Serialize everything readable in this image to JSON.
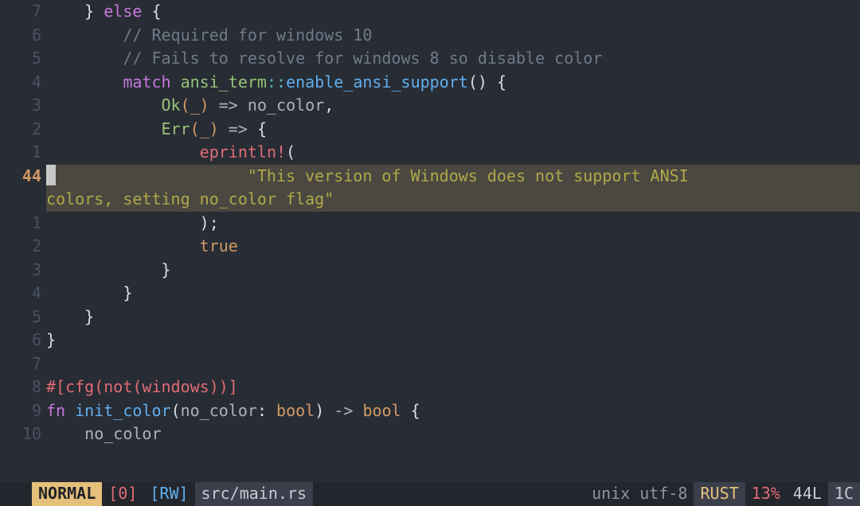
{
  "gutter": [
    "7",
    "6",
    "5",
    "4",
    "3",
    "2",
    "1",
    "44",
    "",
    "1",
    "2",
    "3",
    "4",
    "5",
    "6",
    "7",
    "8",
    "9",
    "10"
  ],
  "code": {
    "l0": {
      "indent": "    ",
      "brace1": "}",
      "sp": " ",
      "kw": "else",
      "sp2": " ",
      "brace2": "{"
    },
    "l1": {
      "indent": "        ",
      "comment": "// Required for windows 10"
    },
    "l2": {
      "indent": "        ",
      "comment": "// Fails to resolve for windows 8 so disable color"
    },
    "l3": {
      "indent": "        ",
      "kw": "match",
      "sp": " ",
      "mod": "ansi_term",
      "cc": "::",
      "fn": "enable_ansi_support",
      "paren": "()",
      "sp2": " ",
      "brace": "{"
    },
    "l4": {
      "indent": "            ",
      "ctor": "Ok",
      "args": "(_)",
      "sp": " ",
      "arrow": "=>",
      "sp2": " ",
      "ident": "no_color",
      "comma": ","
    },
    "l5": {
      "indent": "            ",
      "ctor": "Err",
      "args": "(_)",
      "sp": " ",
      "arrow": "=>",
      "sp2": " ",
      "brace": "{"
    },
    "l6": {
      "indent": "                ",
      "macro": "eprintln!",
      "paren": "("
    },
    "l7": {
      "indent": "                    ",
      "str": "\"This version of Windows does not support ANSI "
    },
    "l7b": {
      "str": "colors, setting no_color flag\""
    },
    "l8": {
      "indent": "                ",
      "close": ");"
    },
    "l9": {
      "indent": "                ",
      "val": "true"
    },
    "l10": {
      "indent": "            ",
      "brace": "}"
    },
    "l11": {
      "indent": "        ",
      "brace": "}"
    },
    "l12": {
      "indent": "    ",
      "brace": "}"
    },
    "l13": {
      "brace": "}"
    },
    "l14": {
      "blank": ""
    },
    "l15": {
      "attr": "#[cfg(not(windows))]"
    },
    "l16": {
      "kw": "fn",
      "sp": " ",
      "name": "init_color",
      "paren1": "(",
      "arg": "no_color",
      "colon": ":",
      "sp2": " ",
      "ty": "bool",
      "paren2": ")",
      "sp3": " ",
      "arrow": "->",
      "sp4": " ",
      "ret": "bool",
      "sp5": " ",
      "brace": "{"
    },
    "l17": {
      "indent": "    ",
      "ident": "no_color"
    }
  },
  "statusbar": {
    "mode": " NORMAL ",
    "zero": "[0]",
    "rw": "[RW]",
    "file": "src/main.rs",
    "enc": "unix utf-8",
    "lang": "RUST",
    "pct": "13%",
    "lines": "44L",
    "col": "1C"
  }
}
